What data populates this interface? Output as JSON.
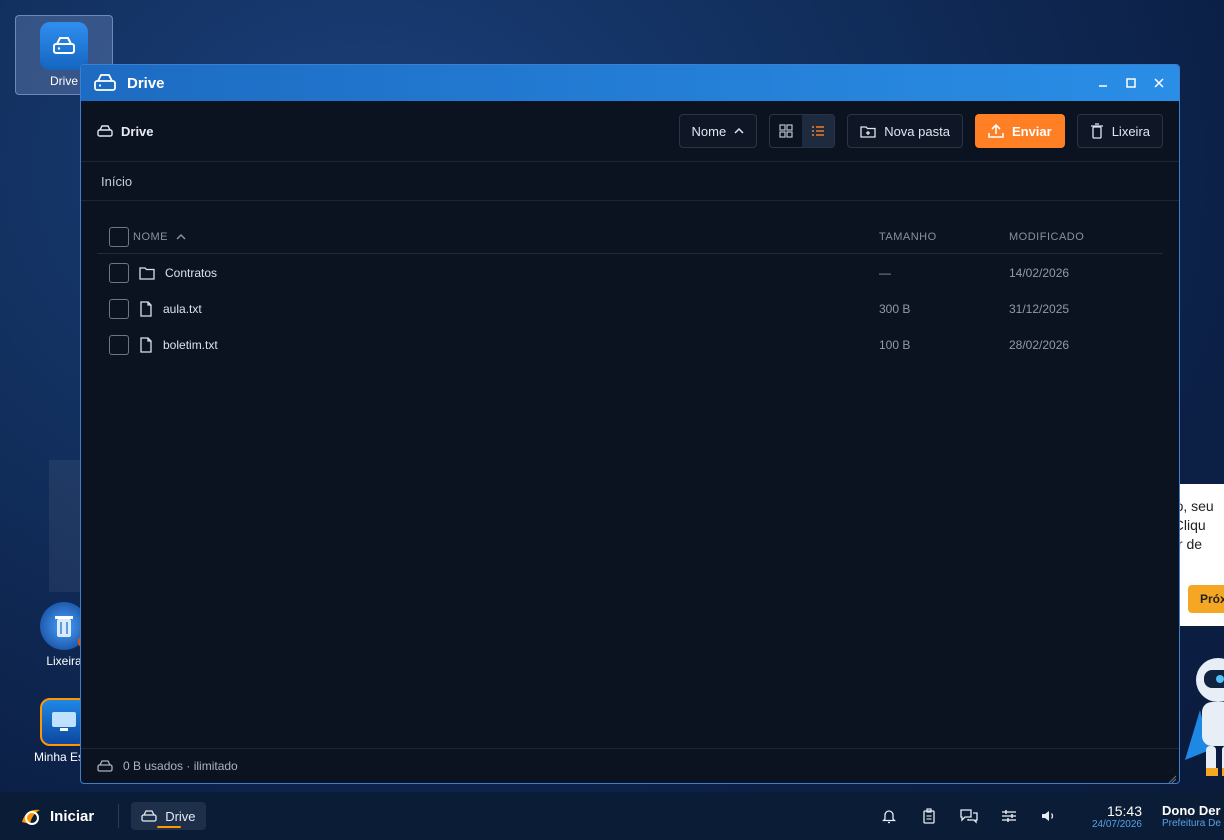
{
  "desktop": {
    "icons": [
      {
        "label": "Drive"
      },
      {
        "label": "Lixeira"
      },
      {
        "label": "Minha Esta"
      }
    ]
  },
  "tour": {
    "lines": [
      "nho, seu",
      "v. Cliqu",
      "isar de"
    ],
    "next_label": "Próx"
  },
  "window": {
    "title": "Drive",
    "toolbar": {
      "location": "Drive",
      "sort_label": "Nome",
      "new_folder_label": "Nova pasta",
      "upload_label": "Enviar",
      "trash_label": "Lixeira",
      "accent": "#ff7f24"
    },
    "breadcrumb": "Início",
    "table": {
      "headers": {
        "name": "NOME",
        "size": "TAMANHO",
        "modified": "MODIFICADO"
      },
      "rows": [
        {
          "type": "folder-icon",
          "name": "Contratos",
          "size": "—",
          "modified": "14/02/2026"
        },
        {
          "type": "file-icon",
          "name": "aula.txt",
          "size": "300 B",
          "modified": "31/12/2025"
        },
        {
          "type": "file-icon",
          "name": "boletim.txt",
          "size": "100 B",
          "modified": "28/02/2026"
        }
      ]
    },
    "status": "0 B usados · ilimitado"
  },
  "taskbar": {
    "start_label": "Iniciar",
    "task_label": "Drive",
    "time": "15:43",
    "date": "24/07/2026",
    "user_name": "Dono Der",
    "user_org": "Prefeitura De"
  }
}
